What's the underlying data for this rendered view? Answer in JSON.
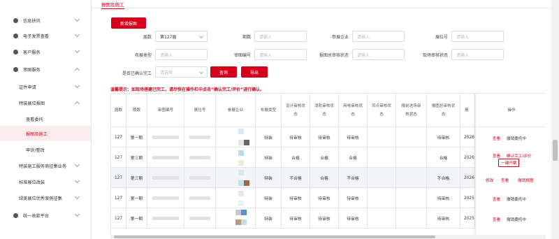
{
  "sidebar": {
    "items": [
      {
        "label": "信息快讯",
        "expanded": false
      },
      {
        "label": "电子发票查看",
        "expanded": false
      },
      {
        "label": "客户服务",
        "expanded": false
      },
      {
        "label": "审图服务",
        "expanded": true
      },
      {
        "label": "证件申请",
        "expanded": false
      },
      {
        "label": "特装展位报图",
        "expanded": true
      },
      {
        "label": "查看委托"
      },
      {
        "label": "报图及施工",
        "active": true
      },
      {
        "label": "申诉/整改"
      },
      {
        "label": "特装施工服务商征集业务",
        "expanded": false
      },
      {
        "label": "标准展位改装",
        "expanded": false
      },
      {
        "label": "绿美展位优秀案例征集",
        "expanded": false
      },
      {
        "label": "统一收款平台",
        "expanded": false
      }
    ]
  },
  "tab": {
    "label": "报图及施工"
  },
  "toolbar": {
    "new_label": "新增报图",
    "query_label": "查询",
    "export_label": "导出"
  },
  "filters": {
    "session": {
      "label": "届数",
      "value": "第127届"
    },
    "phase": {
      "label": "期数",
      "placeholder": "请输入"
    },
    "exhibitor": {
      "label": "参展企业",
      "placeholder": "请输入"
    },
    "booth_no": {
      "label": "展位号",
      "placeholder": "请输入"
    },
    "booth_type": {
      "label": "布展类型",
      "placeholder": "请输入"
    },
    "review_no": {
      "label": "审图编号",
      "placeholder": "请输入"
    },
    "review_status": {
      "label": "报图总审核状态",
      "placeholder": "请输入"
    },
    "site_status": {
      "label": "现场审核状态",
      "placeholder": "请输入"
    },
    "confirm_done": {
      "label": "是否已确认完工",
      "placeholder": "请选择"
    }
  },
  "warning": "温馨提示：如现场搭建已完工，请尽快在操作栏中点击“确认完工/评价”进行确认。",
  "table": {
    "headers": [
      "届数",
      "期数",
      "审图编号",
      "展位号",
      "参展企业",
      "布展类型",
      "设计审核状态",
      "消防审核状态",
      "用电审核状态",
      "吊点审核状态",
      "报前进场审核状态",
      "报图总审核状态",
      "报",
      "操作"
    ],
    "rows": [
      {
        "session": "127",
        "phase": "第一期",
        "type": "特装",
        "design": "待审核",
        "fire": "待审核",
        "power": "待审核",
        "hang": "",
        "pre": "",
        "total": "待审核",
        "date": "2026-0",
        "ops": [
          "查看",
          "撤销委托中"
        ]
      },
      {
        "session": "127",
        "phase": "第三期",
        "type": "特装",
        "design": "合格",
        "fire": "合格",
        "power": "合格",
        "hang": "",
        "pre": "",
        "total": "合格",
        "date": "2026-0",
        "ops": [
          "查看",
          "确认完工/评价",
          "一键开票"
        ]
      },
      {
        "session": "127",
        "phase": "第三期",
        "type": "特装",
        "design": "不合格",
        "fire": "合格",
        "power": "不合格",
        "hang": "",
        "pre": "",
        "total": "不合格",
        "date": "2026-0",
        "ops": [
          "修改",
          "查看",
          "撤销报图"
        ]
      },
      {
        "session": "127",
        "phase": "第一期",
        "type": "特装",
        "design": "待审核",
        "fire": "待审核",
        "power": "待审核",
        "hang": "",
        "pre": "",
        "total": "待审核",
        "date": "2025-1",
        "ops": [
          "查看",
          "撤销委托中"
        ]
      },
      {
        "session": "127",
        "phase": "第一期",
        "type": "特装",
        "design": "待审核",
        "fire": "待审核",
        "power": "待审核",
        "hang": "",
        "pre": "",
        "total": "待审核",
        "date": "2025-1",
        "ops": [
          "查看",
          "撤销委托中"
        ]
      }
    ]
  },
  "colors": {
    "accent": "#d5001c"
  },
  "icons": [
    "info-icon",
    "chevron-down-icon",
    "chevron-up-icon"
  ]
}
